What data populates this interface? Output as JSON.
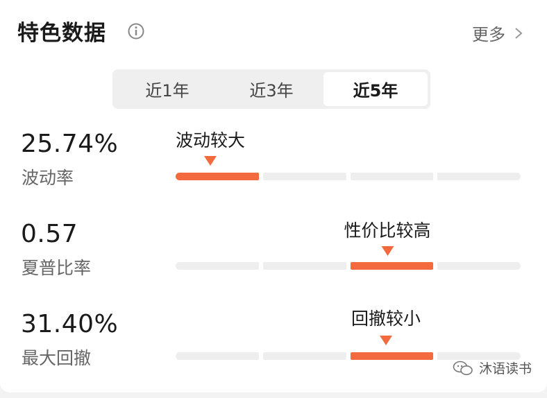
{
  "header": {
    "title": "特色数据",
    "more_label": "更多"
  },
  "tabs": [
    {
      "label": "近1年",
      "active": false
    },
    {
      "label": "近3年",
      "active": false
    },
    {
      "label": "近5年",
      "active": true
    }
  ],
  "metrics": [
    {
      "value": "25.74%",
      "label": "波动率",
      "level_text": "波动较大",
      "active_segment": 1,
      "segment_count": 4
    },
    {
      "value": "0.57",
      "label": "夏普比率",
      "level_text": "性价比较高",
      "active_segment": 3,
      "segment_count": 4
    },
    {
      "value": "31.40%",
      "label": "最大回撤",
      "level_text": "回撤较小",
      "active_segment": 3,
      "segment_count": 4
    }
  ],
  "watermark": {
    "text": "沐语读书"
  },
  "colors": {
    "accent": "#f26a3d",
    "track": "#eeeeee"
  }
}
